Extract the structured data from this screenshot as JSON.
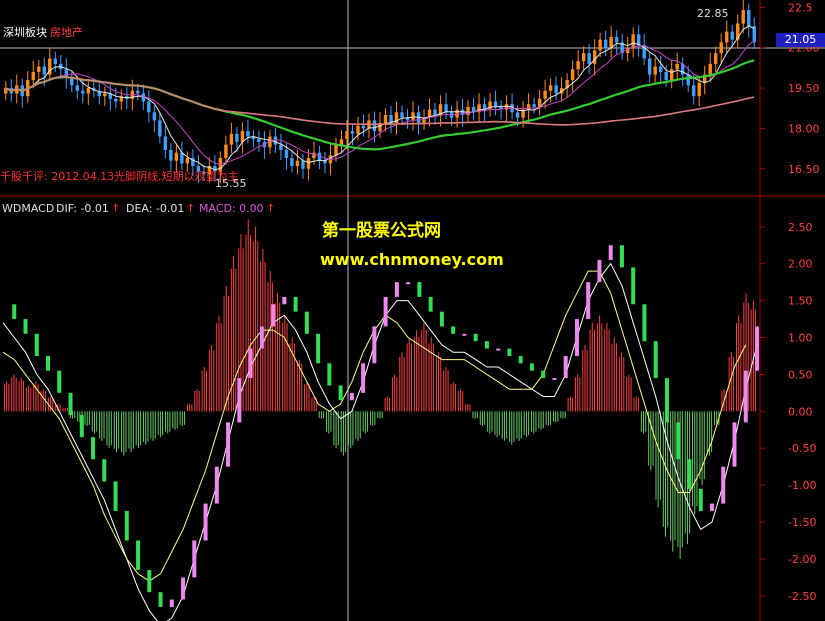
{
  "header": {
    "stock_name": "深圳板块",
    "sector": "房地产",
    "comment": "千股千评: 2012.04.13光脚阴线,短期以观望为主",
    "high_label": "22.85",
    "low_label": "15.55",
    "last_price": "21.05"
  },
  "indicator": {
    "name": "WDMACD",
    "dif_label": "DIF: -0.01",
    "dea_label": "DEA: -0.01",
    "macd_label": "MACD: 0.00",
    "arrow": "↑"
  },
  "watermark": {
    "line1": "第一股票公式网",
    "line2": "www.chnmoney.com"
  },
  "colors": {
    "background": "#000000",
    "up": "#ff8c1a",
    "down": "#3fa0ff",
    "ma_white": "#e8e8e8",
    "ma_magenta": "#cc44cc",
    "ma_green": "#33cc33",
    "ma_pink": "#e07a7a",
    "macd_pos": "#ff4040",
    "macd_neg": "#66cc66",
    "dif": "#ffffff",
    "dea": "#ffff80",
    "axis": "#b00000",
    "tick": "#ff4040",
    "last_price_box": "#2020c0"
  },
  "chart_data": [
    {
      "type": "candlestick",
      "ylim": [
        15.6,
        22.7
      ],
      "ytick_labels": [
        "22.5",
        "21.00",
        "19.50",
        "18.00",
        "16.50"
      ],
      "yticks": [
        22.5,
        21.0,
        19.5,
        18.0,
        16.5
      ],
      "close": [
        19.5,
        19.3,
        19.6,
        19.2,
        19.8,
        20.1,
        20.3,
        20.0,
        20.6,
        20.4,
        20.2,
        19.9,
        19.6,
        19.4,
        19.3,
        19.5,
        19.4,
        19.2,
        19.3,
        19.1,
        19.0,
        19.2,
        19.1,
        19.4,
        19.3,
        19.0,
        18.6,
        18.3,
        17.7,
        17.2,
        16.8,
        17.1,
        16.7,
        16.9,
        16.6,
        16.4,
        16.3,
        16.6,
        16.4,
        16.9,
        17.4,
        17.8,
        17.5,
        17.9,
        17.7,
        17.6,
        17.5,
        17.3,
        17.7,
        17.4,
        17.2,
        16.9,
        16.6,
        16.8,
        16.5,
        16.9,
        17.1,
        16.8,
        16.7,
        17.0,
        17.4,
        17.6,
        17.9,
        17.8,
        18.1,
        18.0,
        18.3,
        17.9,
        18.2,
        18.5,
        18.2,
        18.6,
        18.4,
        18.3,
        18.6,
        18.2,
        18.4,
        18.7,
        18.5,
        18.9,
        18.6,
        18.4,
        18.7,
        18.5,
        18.8,
        18.6,
        18.9,
        18.7,
        19.0,
        18.8,
        18.7,
        18.9,
        18.6,
        18.4,
        18.7,
        18.9,
        18.8,
        19.1,
        19.4,
        19.6,
        19.3,
        19.5,
        19.8,
        20.2,
        20.5,
        20.8,
        20.4,
        20.9,
        21.3,
        21.0,
        21.4,
        21.2,
        20.8,
        21.0,
        21.5,
        21.1,
        20.6,
        20.0,
        20.3,
        20.1,
        19.8,
        20.2,
        20.4,
        20.0,
        19.6,
        19.2,
        19.7,
        20.0,
        20.4,
        20.8,
        21.2,
        21.6,
        21.3,
        21.9,
        22.4,
        21.8,
        21.2
      ],
      "ma_short_name": "",
      "ma_long_names": []
    },
    {
      "type": "bar",
      "ylim": [
        -2.8,
        2.7
      ],
      "ytick_labels": [
        "2.50",
        "2.00",
        "1.50",
        "1.00",
        "0.50",
        "0.00",
        "-0.50",
        "-1.00",
        "-1.50",
        "-2.00",
        "-2.50"
      ],
      "yticks": [
        2.5,
        2.0,
        1.5,
        1.0,
        0.5,
        0.0,
        -0.5,
        -1.0,
        -1.5,
        -2.0,
        -2.5
      ],
      "macd": [
        0.4,
        0.5,
        0.45,
        0.35,
        0.4,
        0.3,
        0.2,
        0.1,
        0.05,
        -0.1,
        -0.15,
        -0.2,
        -0.3,
        -0.4,
        -0.5,
        -0.55,
        -0.6,
        -0.55,
        -0.5,
        -0.45,
        -0.4,
        -0.35,
        -0.3,
        -0.25,
        -0.2,
        0.1,
        0.3,
        0.6,
        0.9,
        1.3,
        1.7,
        2.1,
        2.4,
        2.6,
        2.5,
        2.2,
        1.9,
        1.6,
        1.3,
        1.0,
        0.7,
        0.4,
        0.2,
        -0.1,
        -0.3,
        -0.5,
        -0.6,
        -0.5,
        -0.4,
        -0.3,
        -0.2,
        -0.1,
        0.2,
        0.5,
        0.8,
        1.0,
        1.1,
        1.2,
        1.0,
        0.8,
        0.6,
        0.4,
        0.3,
        0.1,
        -0.1,
        -0.2,
        -0.3,
        -0.35,
        -0.4,
        -0.45,
        -0.4,
        -0.35,
        -0.3,
        -0.25,
        -0.2,
        -0.15,
        -0.1,
        0.2,
        0.5,
        0.9,
        1.2,
        1.3,
        1.2,
        1.0,
        0.8,
        0.5,
        0.2,
        -0.3,
        -0.8,
        -1.3,
        -1.7,
        -1.9,
        -2.0,
        -1.8,
        -1.4,
        -1.0,
        -0.6,
        -0.2,
        0.3,
        0.8,
        1.3,
        1.6,
        1.5
      ],
      "dif": [
        1.2,
        1.0,
        0.8,
        0.5,
        0.3,
        0.0,
        -0.3,
        -0.6,
        -0.9,
        -1.2,
        -1.6,
        -2.0,
        -2.4,
        -2.7,
        -2.9,
        -2.8,
        -2.5,
        -2.0,
        -1.5,
        -1.0,
        -0.4,
        0.2,
        0.6,
        0.9,
        1.2,
        1.3,
        1.1,
        0.8,
        0.4,
        0.1,
        -0.1,
        0.0,
        0.4,
        0.9,
        1.3,
        1.5,
        1.5,
        1.3,
        1.1,
        0.9,
        0.8,
        0.8,
        0.7,
        0.6,
        0.6,
        0.5,
        0.4,
        0.3,
        0.2,
        0.2,
        0.5,
        1.0,
        1.5,
        1.8,
        2.0,
        1.7,
        1.2,
        0.7,
        0.2,
        -0.4,
        -0.9,
        -1.3,
        -1.6,
        -1.5,
        -1.0,
        -0.4,
        0.3,
        0.9
      ],
      "dea": [
        0.8,
        0.7,
        0.5,
        0.3,
        0.1,
        -0.1,
        -0.4,
        -0.7,
        -1.0,
        -1.4,
        -1.7,
        -2.0,
        -2.2,
        -2.3,
        -2.2,
        -1.9,
        -1.6,
        -1.2,
        -0.8,
        -0.3,
        0.2,
        0.6,
        0.9,
        1.1,
        1.1,
        1.0,
        0.7,
        0.4,
        0.1,
        0.0,
        0.1,
        0.4,
        0.8,
        1.1,
        1.3,
        1.2,
        1.0,
        0.9,
        0.8,
        0.7,
        0.7,
        0.7,
        0.6,
        0.5,
        0.4,
        0.3,
        0.3,
        0.3,
        0.5,
        0.9,
        1.3,
        1.6,
        1.9,
        1.9,
        1.6,
        1.1,
        0.6,
        0.1,
        -0.4,
        -0.8,
        -1.1,
        -1.1,
        -0.8,
        -0.4,
        0.1,
        0.6,
        0.9
      ]
    }
  ]
}
